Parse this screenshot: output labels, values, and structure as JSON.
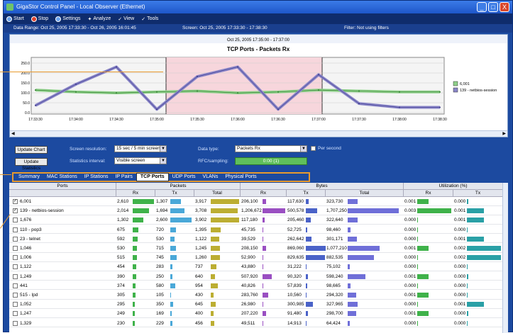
{
  "window": {
    "title": "GigaStor Control Panel - Local Observer (Ethernet)",
    "controls": [
      "_",
      "□",
      "X"
    ]
  },
  "menu": [
    {
      "label": "Start",
      "icon": "start-icon"
    },
    {
      "label": "Stop",
      "icon": "stop-icon"
    },
    {
      "label": "Settings",
      "icon": "settings-icon"
    },
    {
      "label": "Analyze",
      "icon": "analyze-icon"
    },
    {
      "label": "View",
      "icon": "view-icon"
    },
    {
      "label": "Tools",
      "icon": "tools-icon"
    }
  ],
  "info": {
    "data_range": "Data Range: Oct 25, 2005 17:33:30 - Oct 26, 2005 16:01:45",
    "screen": "Screen: Oct 25, 2005 17:33:30 - 17:38:30",
    "filter": "Filter: Not using filters"
  },
  "chart": {
    "range_label": "Oct 25, 2005 17:35:00 - 17:37:00",
    "title": "TCP Ports - Packets Rx",
    "y_ticks": [
      "250.0",
      "200.0",
      "150.0",
      "100.0",
      "50.0",
      "0.0"
    ],
    "x_ticks": [
      "17:33:30",
      "17:34:00",
      "17:34:30",
      "17:35:00",
      "17:35:30",
      "17:36:00",
      "17:36:30",
      "17:37:00",
      "17:37:30",
      "17:38:00",
      "17:38:30"
    ],
    "legend": [
      "6,001",
      "139 - netbios-session"
    ]
  },
  "chart_data": {
    "type": "line",
    "title": "TCP Ports - Packets Rx",
    "x": [
      "17:33:30",
      "17:34:00",
      "17:34:30",
      "17:35:00",
      "17:35:30",
      "17:36:00",
      "17:36:30",
      "17:37:00",
      "17:37:30",
      "17:38:00",
      "17:38:30"
    ],
    "ylim": [
      0,
      250
    ],
    "series": [
      {
        "name": "6,001",
        "color": "#8fd08a",
        "values": [
          110,
          100,
          95,
          100,
          105,
          95,
          100,
          110,
          105,
          100,
          100
        ]
      },
      {
        "name": "139 - netbios-session",
        "color": "#8a86c9",
        "values": [
          30,
          140,
          230,
          10,
          180,
          230,
          10,
          190,
          40,
          20,
          20
        ]
      }
    ]
  },
  "controls": {
    "update_chart": "Update Chart",
    "update_statistics": "Update Statistics",
    "screen_resolution_label": "Screen resolution:",
    "screen_resolution_value": "15 sec / 5 min screen",
    "statistics_interval_label": "Statistics interval:",
    "statistics_interval_value": "Visible screen",
    "data_type_label": "Data type:",
    "data_type_value": "Packets Rx",
    "per_second_label": "Per second",
    "rfc_label": "RFC/sampling:",
    "rfc_value": "0:00 (1)"
  },
  "tabs": [
    "Summary",
    "MAC Stations",
    "IP Stations",
    "IP Pairs",
    "TCP Ports",
    "UDP Ports",
    "VLANs",
    "Physical Ports"
  ],
  "active_tab": "TCP Ports",
  "table": {
    "group_headers": [
      "Ports",
      "Packets",
      "Bytes",
      "Utilization (%)"
    ],
    "col_headers": [
      "Rx",
      "Tx",
      "Total",
      "Rx",
      "Tx",
      "Total",
      "Rx",
      "Tx"
    ],
    "rows": [
      {
        "checked": true,
        "port": "6,001",
        "p_rx": "2,610",
        "p_tx": "1,307",
        "p_tot": "3,917",
        "b_rx": "206,100",
        "b_tx": "117,630",
        "b_tot": "323,730",
        "u_rx": "0.001",
        "u_tx": "0.000"
      },
      {
        "checked": true,
        "port": "139 - netbios-session",
        "p_rx": "2,014",
        "p_tx": "1,694",
        "p_tot": "3,708",
        "b_rx": "1,206,672",
        "b_tx": "500,578",
        "b_tot": "1,707,250",
        "u_rx": "0.003",
        "u_tx": "0.001"
      },
      {
        "checked": false,
        "port": "1,676",
        "p_rx": "1,302",
        "p_tx": "2,600",
        "p_tot": "3,902",
        "b_rx": "117,180",
        "b_tx": "205,460",
        "b_tot": "322,640",
        "u_rx": "0.000",
        "u_tx": "0.001"
      },
      {
        "checked": false,
        "port": "110 - pop3",
        "p_rx": "675",
        "p_tx": "720",
        "p_tot": "1,395",
        "b_rx": "45,735",
        "b_tx": "52,725",
        "b_tot": "98,460",
        "u_rx": "0.000",
        "u_tx": "0.000"
      },
      {
        "checked": false,
        "port": "23 - telnet",
        "p_rx": "592",
        "p_tx": "530",
        "p_tot": "1,122",
        "b_rx": "39,529",
        "b_tx": "262,642",
        "b_tot": "301,171",
        "u_rx": "0.000",
        "u_tx": "0.001"
      },
      {
        "checked": false,
        "port": "1,046",
        "p_rx": "530",
        "p_tx": "715",
        "p_tot": "1,245",
        "b_rx": "208,150",
        "b_tx": "869,060",
        "b_tot": "1,077,210",
        "u_rx": "0.001",
        "u_tx": "0.002"
      },
      {
        "checked": false,
        "port": "1,006",
        "p_rx": "515",
        "p_tx": "745",
        "p_tot": "1,260",
        "b_rx": "52,900",
        "b_tx": "829,635",
        "b_tot": "882,535",
        "u_rx": "0.000",
        "u_tx": "0.002"
      },
      {
        "checked": false,
        "port": "1,122",
        "p_rx": "454",
        "p_tx": "283",
        "p_tot": "737",
        "b_rx": "43,880",
        "b_tx": "31,222",
        "b_tot": "75,102",
        "u_rx": "0.000",
        "u_tx": "0.000"
      },
      {
        "checked": false,
        "port": "1,249",
        "p_rx": "390",
        "p_tx": "250",
        "p_tot": "640",
        "b_rx": "507,920",
        "b_tx": "90,320",
        "b_tot": "598,240",
        "u_rx": "0.001",
        "u_tx": "0.000"
      },
      {
        "checked": false,
        "port": "441",
        "p_rx": "374",
        "p_tx": "580",
        "p_tot": "954",
        "b_rx": "40,826",
        "b_tx": "57,839",
        "b_tot": "98,665",
        "u_rx": "0.000",
        "u_tx": "0.000"
      },
      {
        "checked": false,
        "port": "515 - lpd",
        "p_rx": "305",
        "p_tx": "105",
        "p_tot": "430",
        "b_rx": "283,760",
        "b_tx": "10,560",
        "b_tot": "294,320",
        "u_rx": "0.001",
        "u_tx": "0.000"
      },
      {
        "checked": false,
        "port": "1,052",
        "p_rx": "295",
        "p_tx": "350",
        "p_tot": "645",
        "b_rx": "26,980",
        "b_tx": "300,985",
        "b_tot": "327,965",
        "u_rx": "0.000",
        "u_tx": "0.001"
      },
      {
        "checked": false,
        "port": "1,247",
        "p_rx": "249",
        "p_tx": "169",
        "p_tot": "400",
        "b_rx": "207,220",
        "b_tx": "91,480",
        "b_tot": "298,700",
        "u_rx": "0.001",
        "u_tx": "0.000"
      },
      {
        "checked": false,
        "port": "1,329",
        "p_rx": "230",
        "p_tx": "229",
        "p_tot": "456",
        "b_rx": "49,511",
        "b_tx": "14,913",
        "b_tot": "64,424",
        "u_rx": "0.000",
        "u_tx": "0.000"
      }
    ],
    "bars": {
      "p_rx": [
        1,
        0.77,
        0.5,
        0.26,
        0.23,
        0.2,
        0.2,
        0.17,
        0.15,
        0.14,
        0.12,
        0.11,
        0.1,
        0.09
      ],
      "p_tx": [
        0.5,
        0.65,
        1,
        0.28,
        0.2,
        0.27,
        0.29,
        0.11,
        0.1,
        0.22,
        0.04,
        0.13,
        0.07,
        0.09
      ],
      "p_tot": [
        1,
        0.95,
        1,
        0.36,
        0.29,
        0.32,
        0.32,
        0.19,
        0.16,
        0.24,
        0.11,
        0.17,
        0.1,
        0.12
      ],
      "b_rx": [
        0.17,
        1,
        0.1,
        0.04,
        0.03,
        0.17,
        0.04,
        0.04,
        0.42,
        0.03,
        0.24,
        0.02,
        0.17,
        0.04
      ],
      "b_tx": [
        0.14,
        0.58,
        0.24,
        0.06,
        0.3,
        1,
        0.95,
        0.04,
        0.1,
        0.07,
        0.01,
        0.35,
        0.11,
        0.02
      ],
      "b_tot": [
        0.19,
        1,
        0.19,
        0.06,
        0.18,
        0.63,
        0.52,
        0.04,
        0.35,
        0.06,
        0.17,
        0.19,
        0.17,
        0.04
      ],
      "u_rx": [
        0.33,
        1,
        0.0,
        0.0,
        0.0,
        0.33,
        0.0,
        0.0,
        0.33,
        0.0,
        0.33,
        0.0,
        0.33,
        0.0
      ],
      "u_tx": [
        0.05,
        0.5,
        0.5,
        0.02,
        0.5,
        1,
        1,
        0.02,
        0.05,
        0.02,
        0.02,
        0.5,
        0.05,
        0.02
      ]
    },
    "bar_colors": {
      "packets_rx": "#3fb24a",
      "packets_tx": "#4aa8d8",
      "packets_total": "#bcae32",
      "bytes_rx": "#9a4fc2",
      "bytes_tx": "#4a62c8",
      "bytes_total": "#6f6fd8",
      "util_rx": "#3fb24a",
      "util_tx": "#2aa0a6"
    }
  }
}
